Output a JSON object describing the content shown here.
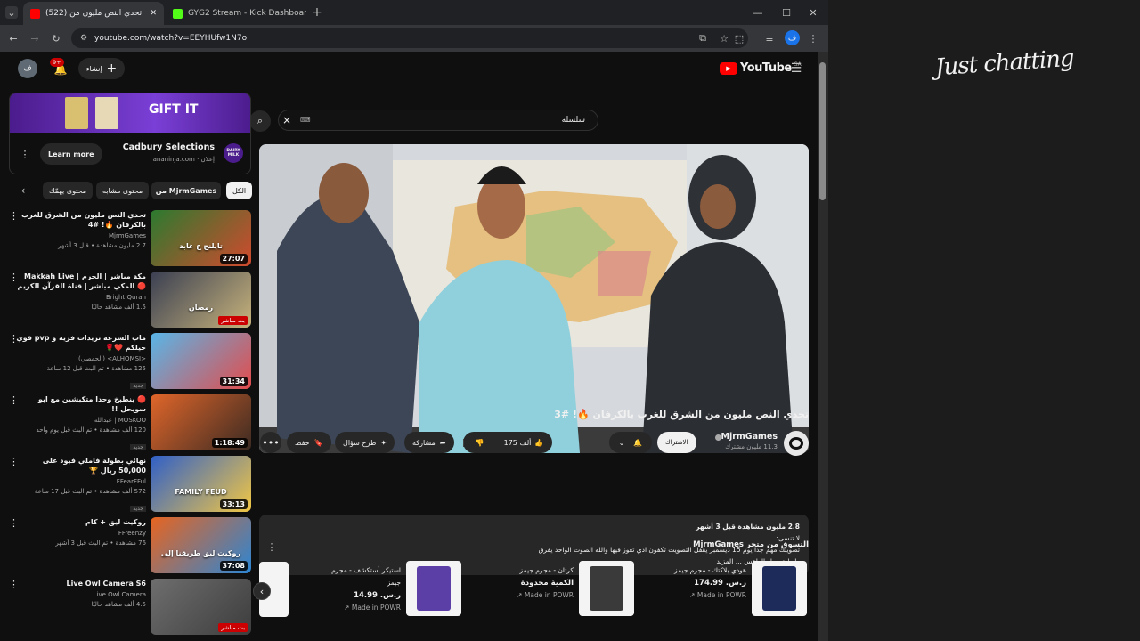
{
  "browser": {
    "tabs": [
      {
        "title": "(522) تحدي النص مليون من",
        "favicon_color": "#ff0000"
      },
      {
        "title": "GYG2 Stream - Kick Dashboard",
        "favicon_color": "#53fc18"
      }
    ],
    "new_tab": "+",
    "url": "youtube.com/watch?v=EEYHUfw1N7o",
    "profile_initial": "ف"
  },
  "youtube": {
    "logo_text": "YouTube",
    "region": "SA",
    "search_value": "سلسله",
    "search_clear": "×",
    "create_label": "إنشاء",
    "notifications_badge": "9+",
    "avatar_initial": "ف"
  },
  "ad": {
    "banner_text": "GIFT IT",
    "title": "Cadbury Selections",
    "sponsor": "إعلان · ananinja.com",
    "cta": "Learn more",
    "brand_logo": "DAIRY MILK"
  },
  "chips": [
    "الكل",
    "من MjrmGames",
    "محتوى مشابه",
    "محتوى يهمّك"
  ],
  "related": [
    {
      "title": "تحدي النص مليون من الشرق للغرب بالكرفان 🔥! #4",
      "channel": "MjrmGames",
      "meta": "2.7 مليون مشاهدة • قبل 3 أشهر",
      "badge": "27:07",
      "live": false,
      "thumb_text": "تايلنج ع غابة",
      "colors": [
        "#2b7a2f",
        "#d24a2e"
      ]
    },
    {
      "title": "مكة مباشر | الحرم | Makkah Live 🔴 المكي مباشر | قناة القرآن الكريم السعودية ...",
      "channel": "Bright Quran",
      "meta": "1.5 ألف مشاهد حاليًا",
      "badge": "بث مباشر",
      "live": true,
      "thumb_text": "رمضان",
      "colors": [
        "#3a3f52",
        "#c7b37b"
      ]
    },
    {
      "title": "ماب السرعة تريدات فرية و pvp قوي حيلكم ❤️🌹",
      "channel": "<ALHOMSI> (الحمصي)",
      "meta": "125 مشاهدة • تم البث قبل 12 ساعة",
      "badge": "31:34",
      "live": false,
      "tag": "جديد",
      "thumb_text": "",
      "colors": [
        "#58b6e8",
        "#e34c4c"
      ]
    },
    {
      "title": "🔴 بنطبخ وحدا متكيشين مع ابو سويحل !!",
      "channel": "MOSKOO | عبدالله",
      "meta": "120 ألف مشاهدة • تم البث قبل يوم واحد",
      "badge": "1:18:49",
      "live": false,
      "tag": "جديد",
      "thumb_text": "",
      "colors": [
        "#e0662a",
        "#3b2a22"
      ]
    },
    {
      "title": "نهائي بطولة فاملي فيود على 50,000 ريال 🏆",
      "channel": "FFearFFul",
      "meta": "572 ألف مشاهدة • تم البث قبل 17 ساعة",
      "badge": "33:13",
      "live": false,
      "tag": "جديد",
      "thumb_text": "FAMILY FEUD",
      "colors": [
        "#2f5fc8",
        "#f2c744"
      ]
    },
    {
      "title": "روكيت ليق + كام",
      "channel": "FFreenzy",
      "meta": "76 مشاهدة • تم البث قبل 3 أشهر",
      "badge": "37:08",
      "live": false,
      "thumb_text": "روكيت ليق طريقنا إلى",
      "colors": [
        "#e8641f",
        "#2c86d4"
      ]
    },
    {
      "title": "Live Owl Camera S6",
      "channel": "Live Owl Camera",
      "meta": "4.5 ألف مشاهد حاليًا",
      "badge": "بث مباشر",
      "live": true,
      "thumb_text": "",
      "colors": [
        "#6e6e6e",
        "#3d3d3d"
      ]
    }
  ],
  "video": {
    "title": "تحدي النص مليون من الشرق للغرب بالكرفان 🔥! #3",
    "channel": "MjrmGames",
    "subscribers": "11.3 مليون مشترك",
    "subscribe_label": "الاشتراك",
    "likes": "175 ألف",
    "share_label": "مشاركة",
    "ask_label": "طرح سؤال",
    "save_label": "حفظ"
  },
  "description": {
    "views_line": "2.8 مليون مشاهدة  قبل 3 أشهر",
    "line1": "لا تنسى:",
    "line2": "تصويتك مهم جدا يوم 15 ديسمبر يقفل التصويت تكفون ادي تعوز فيها والله الصوت الواحد يفرق",
    "line3": "رابط تحميل الطقس ... المزيد"
  },
  "store": {
    "header": "التسوق من متجر MjrmGames",
    "products": [
      {
        "name": "هودي بلاكتك - مجرم جيمز",
        "price": "ر.س. 174.99",
        "source": "Made in POWR",
        "color": "#1c2b5a"
      },
      {
        "name": "كرتان - مجرم جيمز",
        "price": "الكمية محدودة",
        "source": "Made in POWR",
        "color": "#3a3a3a"
      },
      {
        "name": "استيكر أستكشف - مجرم جيمز",
        "price": "ر.س. 14.99",
        "source": "Made in POWR",
        "color": "#5b3fa6"
      }
    ]
  },
  "overlay": {
    "signature": "Just chatting"
  }
}
